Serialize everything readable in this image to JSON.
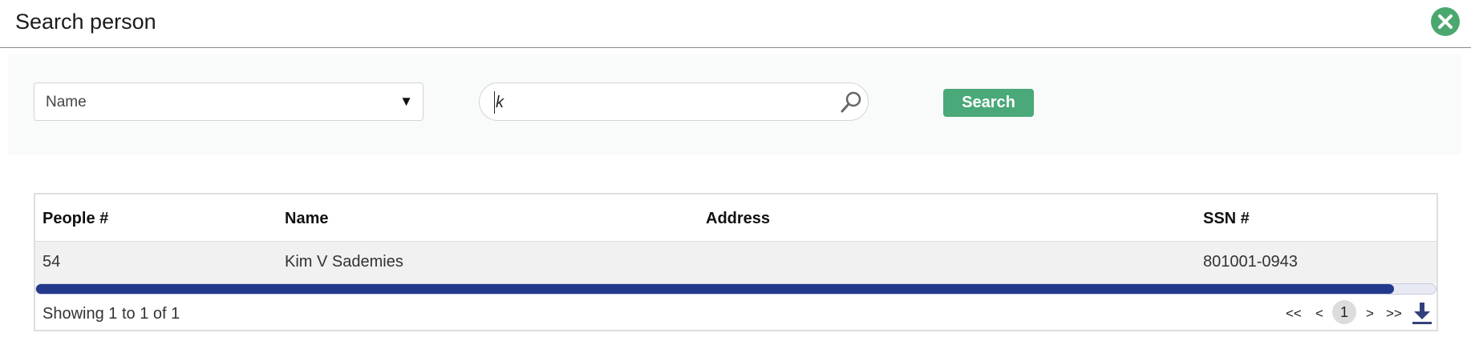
{
  "dialog": {
    "title": "Search person"
  },
  "search": {
    "field_select_value": "Name",
    "query_value": "k",
    "button_label": "Search"
  },
  "table": {
    "columns": [
      "People #",
      "Name",
      "Address",
      "SSN #"
    ],
    "rows": [
      {
        "people_no": "54",
        "name": "Kim V Sademies",
        "address": "",
        "ssn": "801001-0943"
      }
    ],
    "scroll_position_fraction": 0.97
  },
  "footer": {
    "showing_text": "Showing 1 to 1 of 1",
    "pager": {
      "first": "<<",
      "prev": "<",
      "current_page": "1",
      "next": ">",
      "last": ">>"
    }
  },
  "icons": {
    "close": "close-icon",
    "search": "search-icon",
    "dropdown": "triangle-down-icon",
    "download": "download-icon"
  },
  "colors": {
    "accent_green": "#4aa879",
    "scrollbar_thumb": "#233a8c"
  }
}
